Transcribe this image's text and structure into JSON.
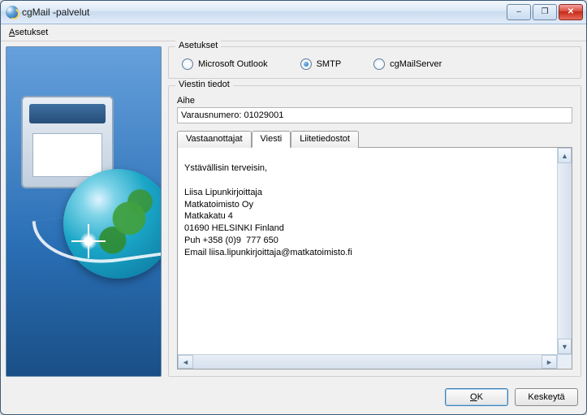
{
  "window": {
    "title": "cgMail -palvelut"
  },
  "menu": {
    "asetukset": "Asetukset",
    "asetukset_accel": "A"
  },
  "settings_group": {
    "legend": "Asetukset",
    "radios": {
      "outlook": "Microsoft Outlook",
      "smtp": "SMTP",
      "cgmail": "cgMailServer",
      "selected": "smtp"
    }
  },
  "message_group": {
    "legend": "Viestin tiedot",
    "subject_label": "Aihe",
    "subject_value": "Varausnumero: 01029001",
    "tabs": {
      "recipients": "Vastaanottajat",
      "message": "Viesti",
      "attachments": "Liitetiedostot",
      "active": "message"
    },
    "body": "Ystävällisin terveisin,\n\nLiisa Lipunkirjoittaja\nMatkatoimisto Oy\nMatkakatu 4\n01690 HELSINKI Finland\nPuh +358 (0)9  777 650\nEmail liisa.lipunkirjoittaja@matkatoimisto.fi"
  },
  "buttons": {
    "ok": "OK",
    "ok_accel": "O",
    "cancel": "Keskeytä"
  },
  "icons": {
    "app": "globe-mail-icon",
    "minimize": "–",
    "maximize": "❐",
    "close": "✕",
    "arrow_up": "▲",
    "arrow_down": "▼",
    "arrow_left": "◄",
    "arrow_right": "►"
  }
}
